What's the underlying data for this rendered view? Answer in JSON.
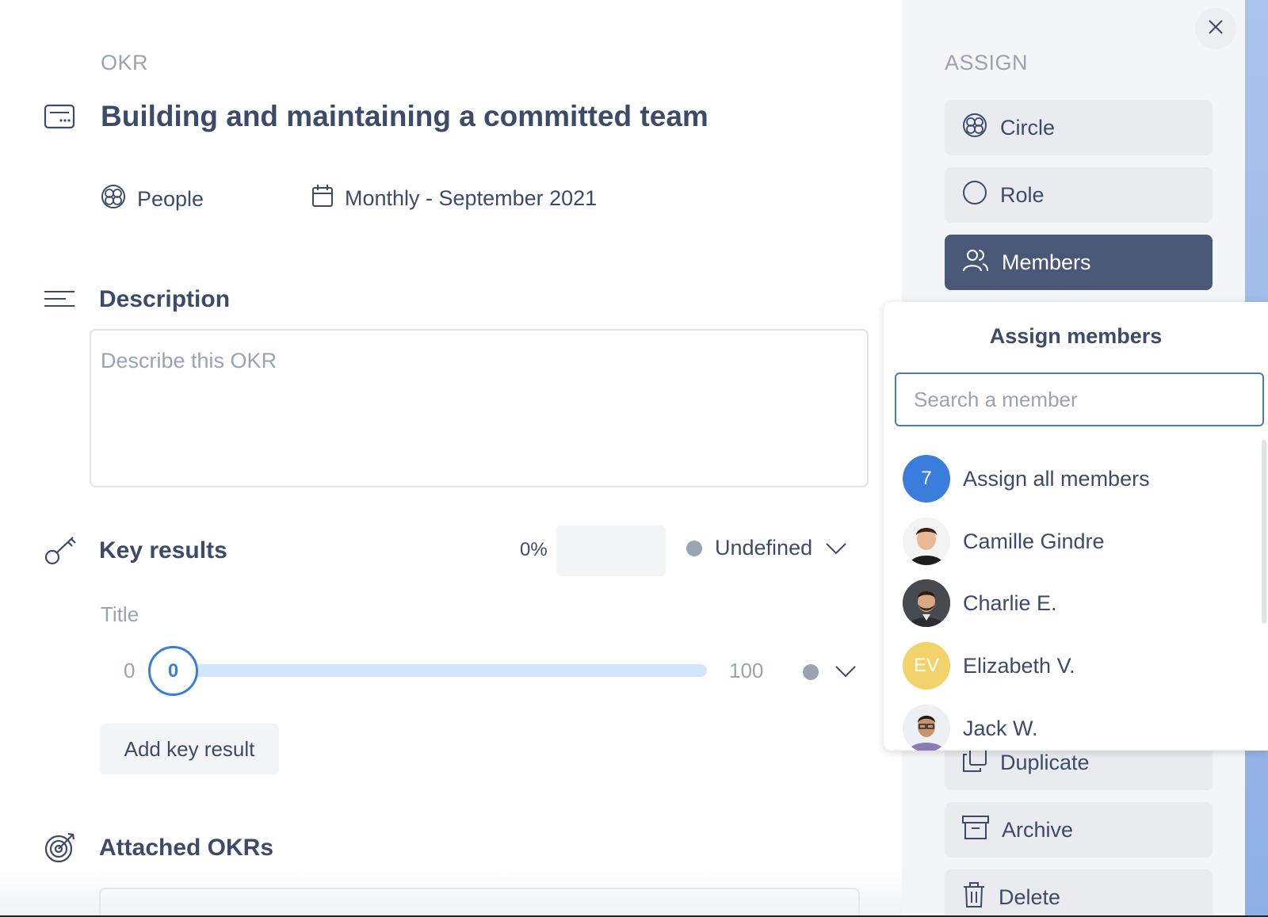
{
  "okr": {
    "section_label": "OKR",
    "title": "Building and maintaining a committed team",
    "circle": "People",
    "period": "Monthly - September 2021"
  },
  "description": {
    "heading": "Description",
    "placeholder": "Describe this OKR"
  },
  "key_results": {
    "heading": "Key results",
    "progress_label": "0%",
    "status": "Undefined",
    "items": [
      {
        "title": "Title",
        "min": "0",
        "current": "0",
        "max": "100",
        "progress": 0
      }
    ],
    "add_label": "Add key result"
  },
  "attached": {
    "heading": "Attached OKRs"
  },
  "sidebar": {
    "heading": "ASSIGN",
    "buttons": [
      {
        "label": "Circle",
        "icon": "circle-group-icon"
      },
      {
        "label": "Role",
        "icon": "role-circle-icon"
      },
      {
        "label": "Members",
        "icon": "members-icon",
        "active": true
      }
    ],
    "actions": [
      {
        "label": "Duplicate",
        "icon": "duplicate-icon"
      },
      {
        "label": "Archive",
        "icon": "archive-icon"
      },
      {
        "label": "Delete",
        "icon": "trash-icon"
      }
    ]
  },
  "assign_popup": {
    "heading": "Assign members",
    "search_placeholder": "Search a member",
    "all": {
      "count": "7",
      "label": "Assign all members"
    },
    "members": [
      {
        "name": "Camille Gindre"
      },
      {
        "name": "Charlie E."
      },
      {
        "name": "Elizabeth V.",
        "initials": "EV"
      },
      {
        "name": "Jack W."
      }
    ]
  },
  "colors": {
    "accent": "#3b7ddd",
    "active_button": "#4a5878",
    "text": "#3d4b6b",
    "muted": "#9aa3b2",
    "ev_avatar": "#f2d36b"
  }
}
